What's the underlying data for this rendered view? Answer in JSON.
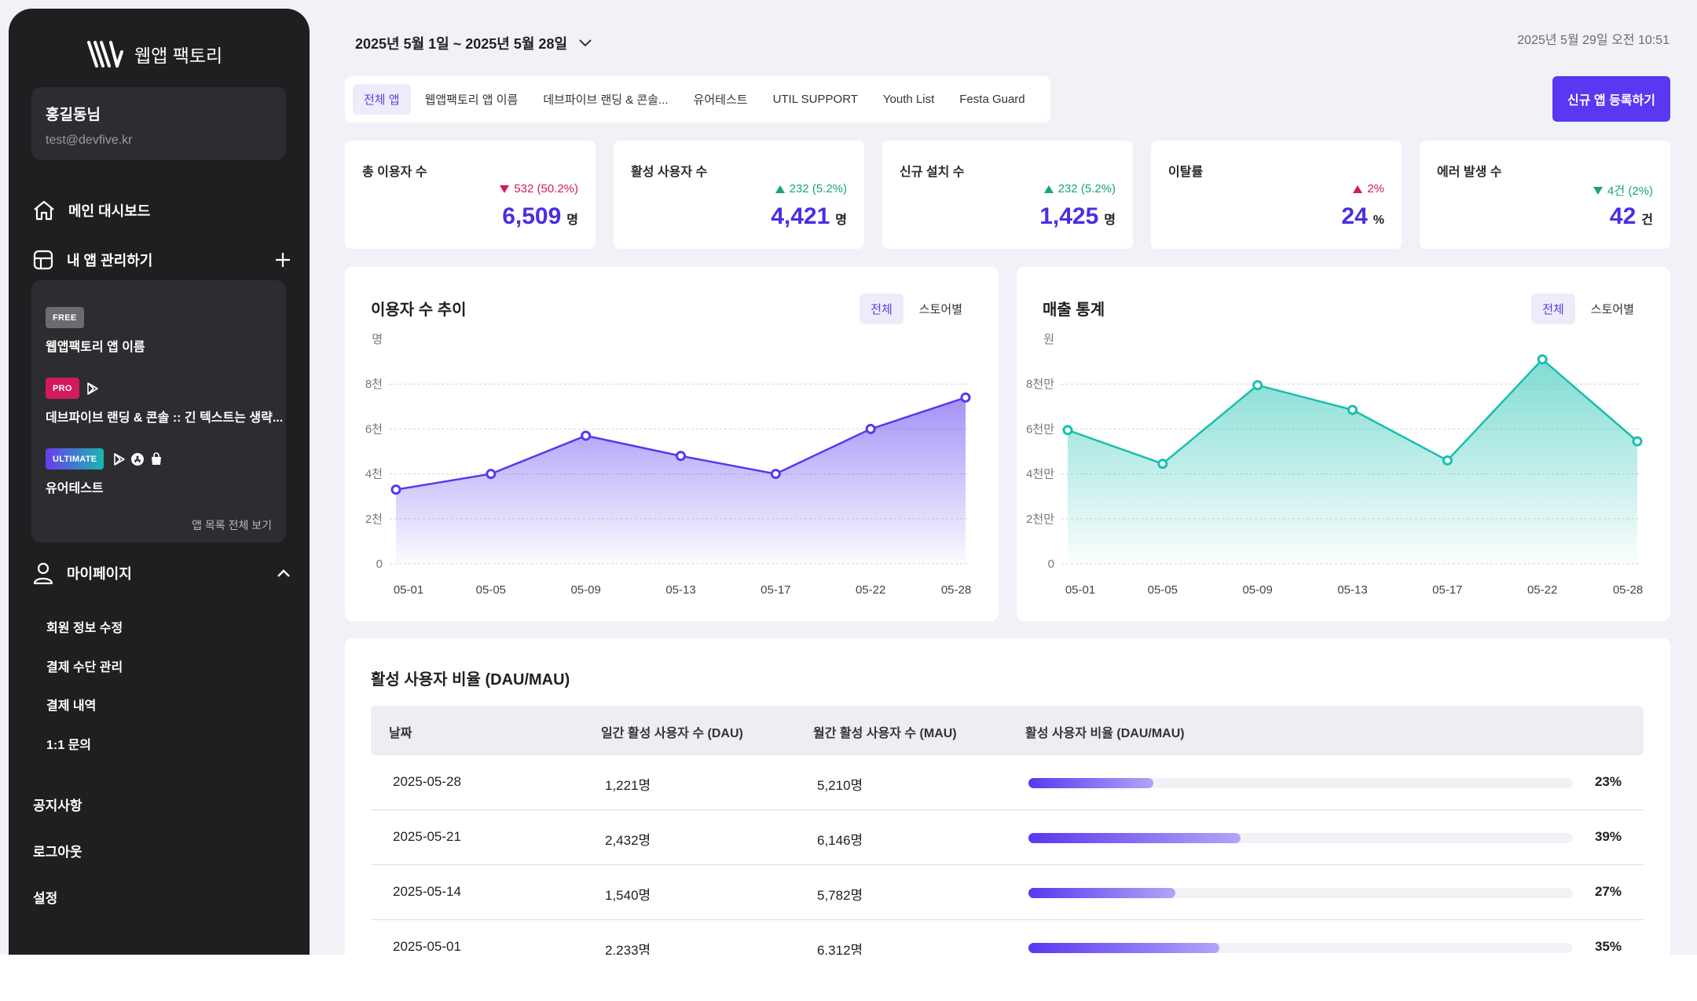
{
  "app": {
    "name": "웹앱 팩토리"
  },
  "user": {
    "name": "홍길동님",
    "email": "test@devfive.kr"
  },
  "nav": {
    "dashboard": "메인 대시보드",
    "my_apps": "내 앱 관리하기",
    "mypage": "마이페이지",
    "apps": [
      {
        "badge": "FREE",
        "name": "웹앱팩토리 앱 이름",
        "badge_color": "#6b6b70"
      },
      {
        "badge": "PRO",
        "name": "데브파이브 랜딩 & 콘솔 :: 긴 텍스트는 생략...",
        "badge_color": "#d3195f"
      },
      {
        "badge": "ULTIMATE",
        "name": "유어테스트",
        "badge_color": "#6a3cf0"
      }
    ],
    "view_all": "앱 목록 전체 보기",
    "sub": [
      "회원 정보 수정",
      "결제 수단 관리",
      "결제 내역",
      "1:1 문의"
    ],
    "bottom": [
      "공지사항",
      "로그아웃",
      "설정"
    ]
  },
  "header": {
    "date_range": "2025년 5월 1일 ~ 2025년 5월 28일",
    "timestamp": "2025년 5월 29일 오전 10:51",
    "new_app": "신규 앱 등록하기"
  },
  "tabs": [
    "전체 앱",
    "웹앱팩토리 앱 이름",
    "데브파이브 랜딩 & 콘솔...",
    "유어테스트",
    "UTIL SUPPORT",
    "Youth List",
    "Festa Guard"
  ],
  "stats": [
    {
      "label": "총 이용자 수",
      "delta": "532 (50.2%)",
      "direction": "down",
      "value": "6,509",
      "unit": "명"
    },
    {
      "label": "활성 사용자 수",
      "delta": "232 (5.2%)",
      "direction": "up",
      "value": "4,421",
      "unit": "명"
    },
    {
      "label": "신규 설치 수",
      "delta": "232 (5.2%)",
      "direction": "up",
      "value": "1,425",
      "unit": "명"
    },
    {
      "label": "이탈률",
      "delta": "2%",
      "direction": "up-bad",
      "value": "24",
      "unit": "%"
    },
    {
      "label": "에러 발생 수",
      "delta": "4건 (2%)",
      "direction": "down-good",
      "value": "42",
      "unit": "건"
    }
  ],
  "colors": {
    "up": "#16a37f",
    "down": "#d3195f",
    "accent": "#5a37f0",
    "teal": "#17bfae"
  },
  "users_chart": {
    "title": "이용자 수 추이",
    "seg_all": "전체",
    "seg_store": "스토어별"
  },
  "revenue_chart": {
    "title": "매출 통계",
    "seg_all": "전체",
    "seg_store": "스토어별"
  },
  "chart_data": [
    {
      "type": "area",
      "title": "이용자 수 추이",
      "ylabel": "명",
      "x": [
        "05-01",
        "05-05",
        "05-09",
        "05-13",
        "05-17",
        "05-22",
        "05-28"
      ],
      "y_ticks": [
        "0",
        "2천",
        "4천",
        "6천",
        "8천"
      ],
      "ylim": [
        0,
        10000
      ],
      "series": [
        {
          "values": [
            3300,
            4000,
            5700,
            4800,
            4000,
            6000,
            7400
          ]
        }
      ],
      "grid": true
    },
    {
      "type": "area",
      "title": "매출 통계",
      "ylabel": "원",
      "x": [
        "05-01",
        "05-05",
        "05-09",
        "05-13",
        "05-17",
        "05-22",
        "05-28"
      ],
      "y_ticks": [
        "0",
        "2천만",
        "4천만",
        "6천만",
        "8천만"
      ],
      "ylim": [
        0,
        100000000
      ],
      "series": [
        {
          "values": [
            59500000,
            44500000,
            79500000,
            68500000,
            46000000,
            91000000,
            54500000
          ]
        }
      ],
      "grid": true
    }
  ],
  "dau_table": {
    "title": "활성 사용자 비율 (DAU/MAU)",
    "headers": [
      "날짜",
      "일간 활성 사용자 수 (DAU)",
      "월간 활성 사용자 수 (MAU)",
      "활성 사용자 비율 (DAU/MAU)"
    ],
    "rows": [
      {
        "date": "2025-05-28",
        "dau": "1,221명",
        "mau": "5,210명",
        "ratio": 0.23,
        "pct": "23%"
      },
      {
        "date": "2025-05-21",
        "dau": "2,432명",
        "mau": "6,146명",
        "ratio": 0.39,
        "pct": "39%"
      },
      {
        "date": "2025-05-14",
        "dau": "1,540명",
        "mau": "5,782명",
        "ratio": 0.27,
        "pct": "27%"
      },
      {
        "date": "2025-05-01",
        "dau": "2,233명",
        "mau": "6,312명",
        "ratio": 0.35,
        "pct": "35%"
      }
    ]
  }
}
